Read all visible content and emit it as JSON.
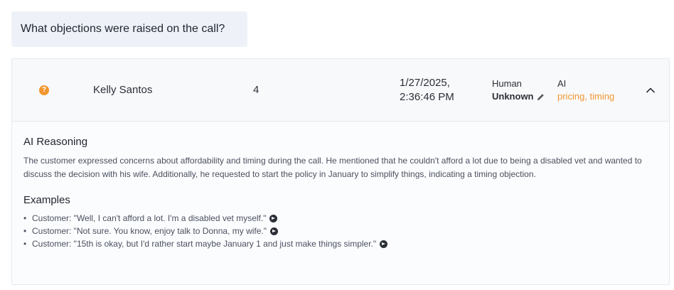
{
  "question": "What objections were raised on the call?",
  "row": {
    "status_icon": "?",
    "name": "Kelly Santos",
    "count": "4",
    "date_line1": "1/27/2025,",
    "date_line2": "2:36:46 PM",
    "human_label": "Human",
    "human_value": "Unknown",
    "ai_label": "AI",
    "ai_value": "pricing, timing"
  },
  "detail": {
    "reasoning_title": "AI Reasoning",
    "reasoning_text": "The customer expressed concerns about affordability and timing during the call. He mentioned that he couldn't afford a lot due to being a disabled vet and wanted to discuss the decision with his wife. Additionally, he requested to start the policy in January to simplify things, indicating a timing objection.",
    "examples_title": "Examples",
    "examples": [
      "Customer: \"Well, I can't afford a lot. I'm a disabled vet myself.\"",
      "Customer: \"Not sure. You know, enjoy talk to Donna, my wife.\"",
      "Customer: \"15th is okay, but I'd rather start maybe January 1 and just make things simpler.\""
    ]
  },
  "colors": {
    "accent_orange": "#f2962f",
    "question_bg": "#eef2f8"
  },
  "icons": {
    "status": "question-mark-circle-icon",
    "edit": "pencil-icon",
    "collapse": "chevron-up-icon",
    "go": "arrow-right-circle-icon"
  }
}
